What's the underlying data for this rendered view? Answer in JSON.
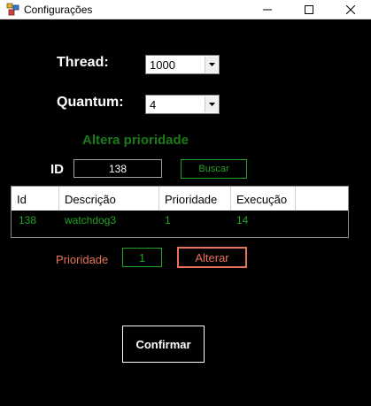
{
  "window": {
    "title": "Configurações"
  },
  "thread": {
    "label": "Thread:",
    "value": "1000"
  },
  "quantum": {
    "label": "Quantum:",
    "value": "4"
  },
  "priority_section": {
    "title": "Altera prioridade",
    "id_label": "ID",
    "id_value": "138",
    "search_button": "Buscar"
  },
  "table": {
    "columns": [
      "Id",
      "Descrição",
      "Prioridade",
      "Execução"
    ],
    "rows": [
      [
        "138",
        "watchdog3",
        "1",
        "14"
      ]
    ]
  },
  "alter": {
    "label": "Prioridade",
    "value": "1",
    "button": "Alterar"
  },
  "confirm_button": "Confirmar",
  "colors": {
    "background": "#000000",
    "green": "#23a323",
    "salmon": "#e8735a"
  }
}
